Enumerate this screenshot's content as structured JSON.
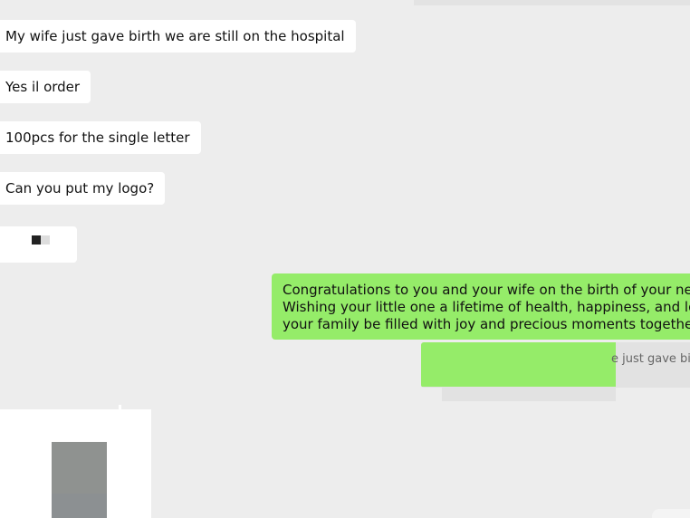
{
  "messages_in": [
    "My wife just gave birth we are still on the hospital",
    "Yes il order",
    "100pcs for the single letter",
    "Can you put my logo?"
  ],
  "message_out": {
    "lines": [
      "Congratulations to you and your wife on the birth of your new baby.",
      "Wishing your little one a lifetime of health, happiness, and love. May",
      "your family be filled with joy and precious moments together."
    ]
  },
  "quote": {
    "text": "e just gave birt"
  },
  "colors": {
    "bg": "#ededed",
    "incoming": "#ffffff",
    "outgoing": "#95ec69"
  }
}
